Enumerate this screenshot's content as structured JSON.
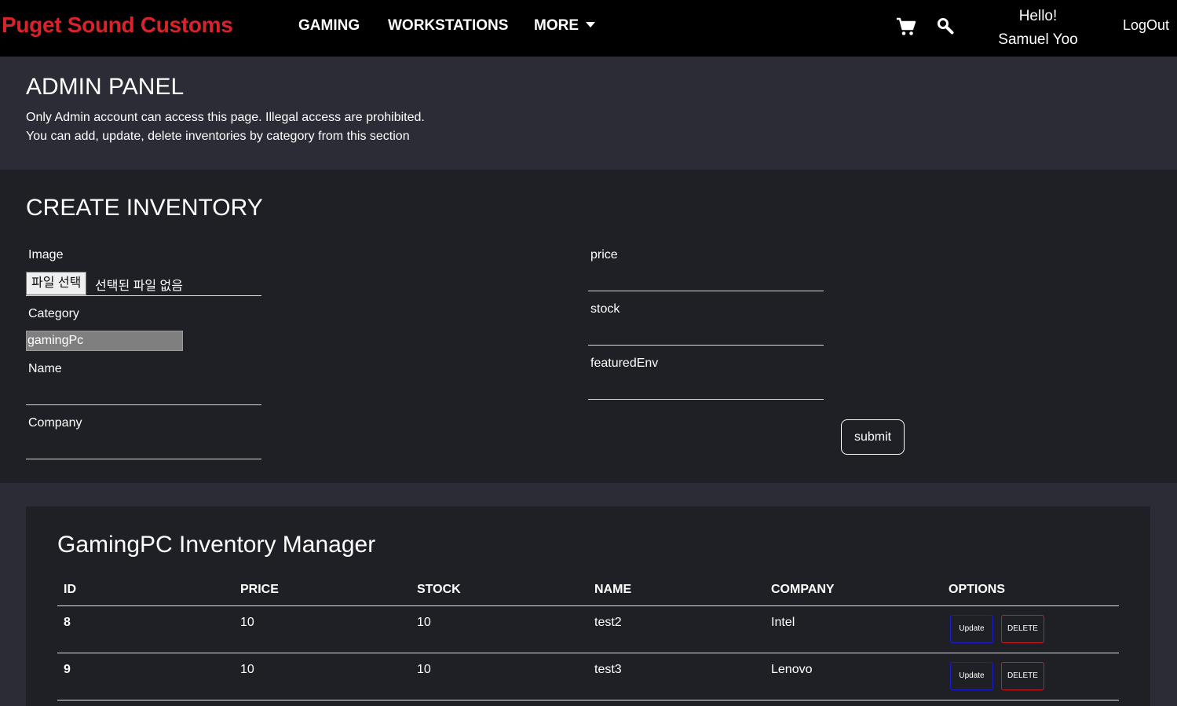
{
  "nav": {
    "brand": "Puget Sound Customs",
    "links": [
      "GAMING",
      "WORKSTATIONS",
      "MORE"
    ],
    "greeting": "Hello!",
    "user": "Samuel Yoo",
    "logout": "LogOut",
    "icons": [
      "cart-icon",
      "search-icon",
      "chevron-down-icon"
    ]
  },
  "admin": {
    "title": "ADMIN PANEL",
    "line1": "Only Admin account can access this page. Illegal access are prohibited.",
    "line2": "You can add, update, delete inventories by category from this section"
  },
  "create": {
    "title": "CREATE INVENTORY",
    "image_label": "Image",
    "file_button": "파일 선택",
    "file_status": "선택된 파일 없음",
    "category_label": "Category",
    "category_value": "gamingPc",
    "name_label": "Name",
    "company_label": "Company",
    "price_label": "price",
    "stock_label": "stock",
    "featured_label": "featuredEnv",
    "submit": "submit"
  },
  "manager": {
    "title": "GamingPC Inventory Manager",
    "columns": [
      "ID",
      "PRICE",
      "STOCK",
      "NAME",
      "COMPANY",
      "OPTIONS"
    ],
    "rows": [
      {
        "id": "8",
        "price": "10",
        "stock": "10",
        "name": "test2",
        "company": "Intel",
        "update": "Update",
        "delete": "DELETE"
      },
      {
        "id": "9",
        "price": "10",
        "stock": "10",
        "name": "test3",
        "company": "Lenovo",
        "update": "Update",
        "delete": "DELETE"
      }
    ]
  },
  "colors": {
    "brand": "#d8232a",
    "update_border": "#1a1ad0",
    "delete_border": "#d31b1b"
  }
}
